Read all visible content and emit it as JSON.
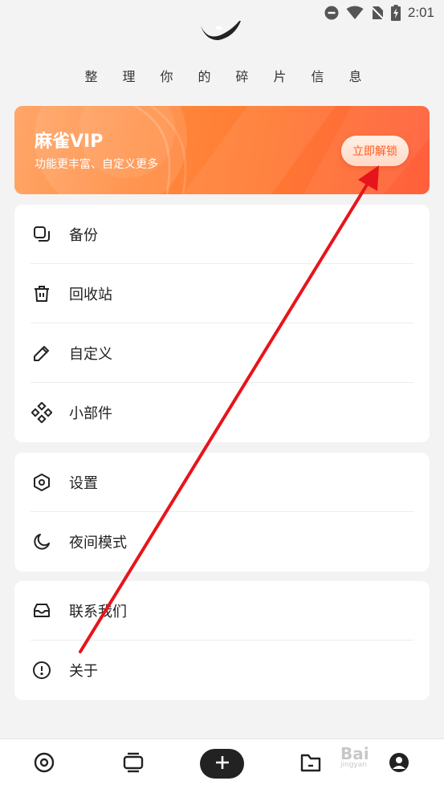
{
  "status_bar": {
    "time": "2:01"
  },
  "header": {
    "tagline": "整理你的碎片信息"
  },
  "vip_banner": {
    "title": "麻雀VIP",
    "subtitle": "功能更丰富、自定义更多",
    "unlock_label": "立即解锁"
  },
  "menu_group_1": {
    "items": [
      {
        "label": "备份",
        "icon": "backup-icon"
      },
      {
        "label": "回收站",
        "icon": "trash-icon"
      },
      {
        "label": "自定义",
        "icon": "pencil-icon"
      },
      {
        "label": "小部件",
        "icon": "widget-icon"
      }
    ]
  },
  "menu_group_2": {
    "items": [
      {
        "label": "设置",
        "icon": "settings-icon"
      },
      {
        "label": "夜间模式",
        "icon": "moon-icon"
      }
    ]
  },
  "menu_group_3": {
    "items": [
      {
        "label": "联系我们",
        "icon": "inbox-icon"
      },
      {
        "label": "关于",
        "icon": "info-icon"
      }
    ]
  },
  "bottom_nav": {
    "items": [
      "record-icon",
      "cards-icon",
      "add-icon",
      "folder-icon",
      "profile-icon"
    ]
  },
  "watermark": {
    "brand": "Bai",
    "sub": "jingyan"
  },
  "colors": {
    "accent": "#ff7a32",
    "button_text": "#ff5b24",
    "annotation": "#e8141b"
  }
}
